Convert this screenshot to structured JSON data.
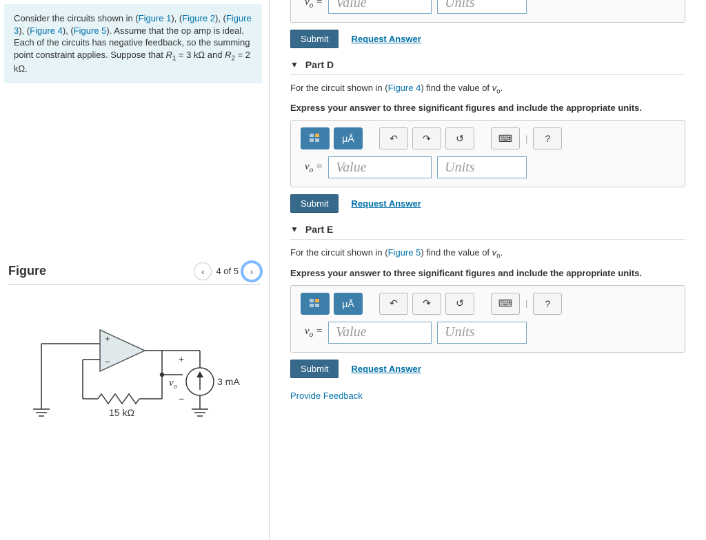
{
  "intro": {
    "pre": "Consider the circuits shown in (",
    "fig1": "Figure 1",
    "sep1": "), (",
    "fig2": "Figure 2",
    "sep2": "), (",
    "fig3": "Figure 3",
    "sep3": "), (",
    "fig4": "Figure 4",
    "sep4": "), (",
    "fig5": "Figure 5",
    "tail": "). Assume that the op amp is ideal. Each of the circuits has negative feedback, so the summing point constraint applies. Suppose that ",
    "r1v": "R",
    "r1s": "1",
    "r1eq": " = 3 kΩ and ",
    "r2v": "R",
    "r2s": "2",
    "r2eq": " = 2 kΩ."
  },
  "figure": {
    "title": "Figure",
    "page_label": "4 of 5",
    "r_label": "15 kΩ",
    "vo_label": "v",
    "vo_sub": "o",
    "i_label": "3 mA",
    "plus": "+",
    "minus": "−"
  },
  "common": {
    "vo_eq": "v",
    "vo_sub": "o",
    "equals": " = ",
    "value_ph": "Value",
    "units_ph": "Units",
    "submit": "Submit",
    "request": "Request Answer",
    "ua": "μÅ",
    "help": "?",
    "prompt_instr": "Express your answer to three significant figures and include the appropriate units."
  },
  "partD": {
    "title": "Part D",
    "prompt_pre": "For the circuit shown in (",
    "figlink": "Figure 4",
    "prompt_post": ") find the value of ",
    "vo": "v",
    "vo_sub": "o",
    "dot": "."
  },
  "partE": {
    "title": "Part E",
    "prompt_pre": "For the circuit shown in (",
    "figlink": "Figure 5",
    "prompt_post": ") find the value of ",
    "vo": "v",
    "vo_sub": "o",
    "dot": "."
  },
  "feedback": "Provide Feedback"
}
